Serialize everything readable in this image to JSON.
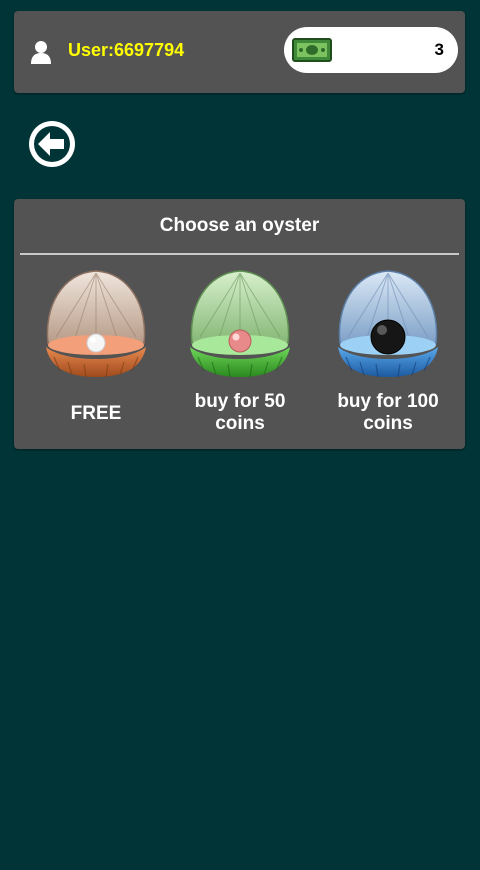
{
  "header": {
    "user_label": "User:6697794",
    "coin_count": "3",
    "user_icon": "user-icon",
    "money_icon": "money-icon"
  },
  "back_button": {
    "icon": "arrow-left-icon"
  },
  "panel": {
    "title": "Choose an oyster",
    "options": [
      {
        "label": "FREE",
        "pearl": "white",
        "shell_color": "#d8c4b4",
        "lip_color": "#c8602a"
      },
      {
        "label": "buy for 50 coins",
        "pearl": "pink",
        "shell_color": "#a8d89a",
        "lip_color": "#3fa82e"
      },
      {
        "label": "buy for 100 coins",
        "pearl": "black",
        "shell_color": "#a9c6e4",
        "lip_color": "#2a76c4"
      }
    ]
  },
  "colors": {
    "background": "#013437",
    "panel": "#535353",
    "user_label": "#fffd01"
  }
}
